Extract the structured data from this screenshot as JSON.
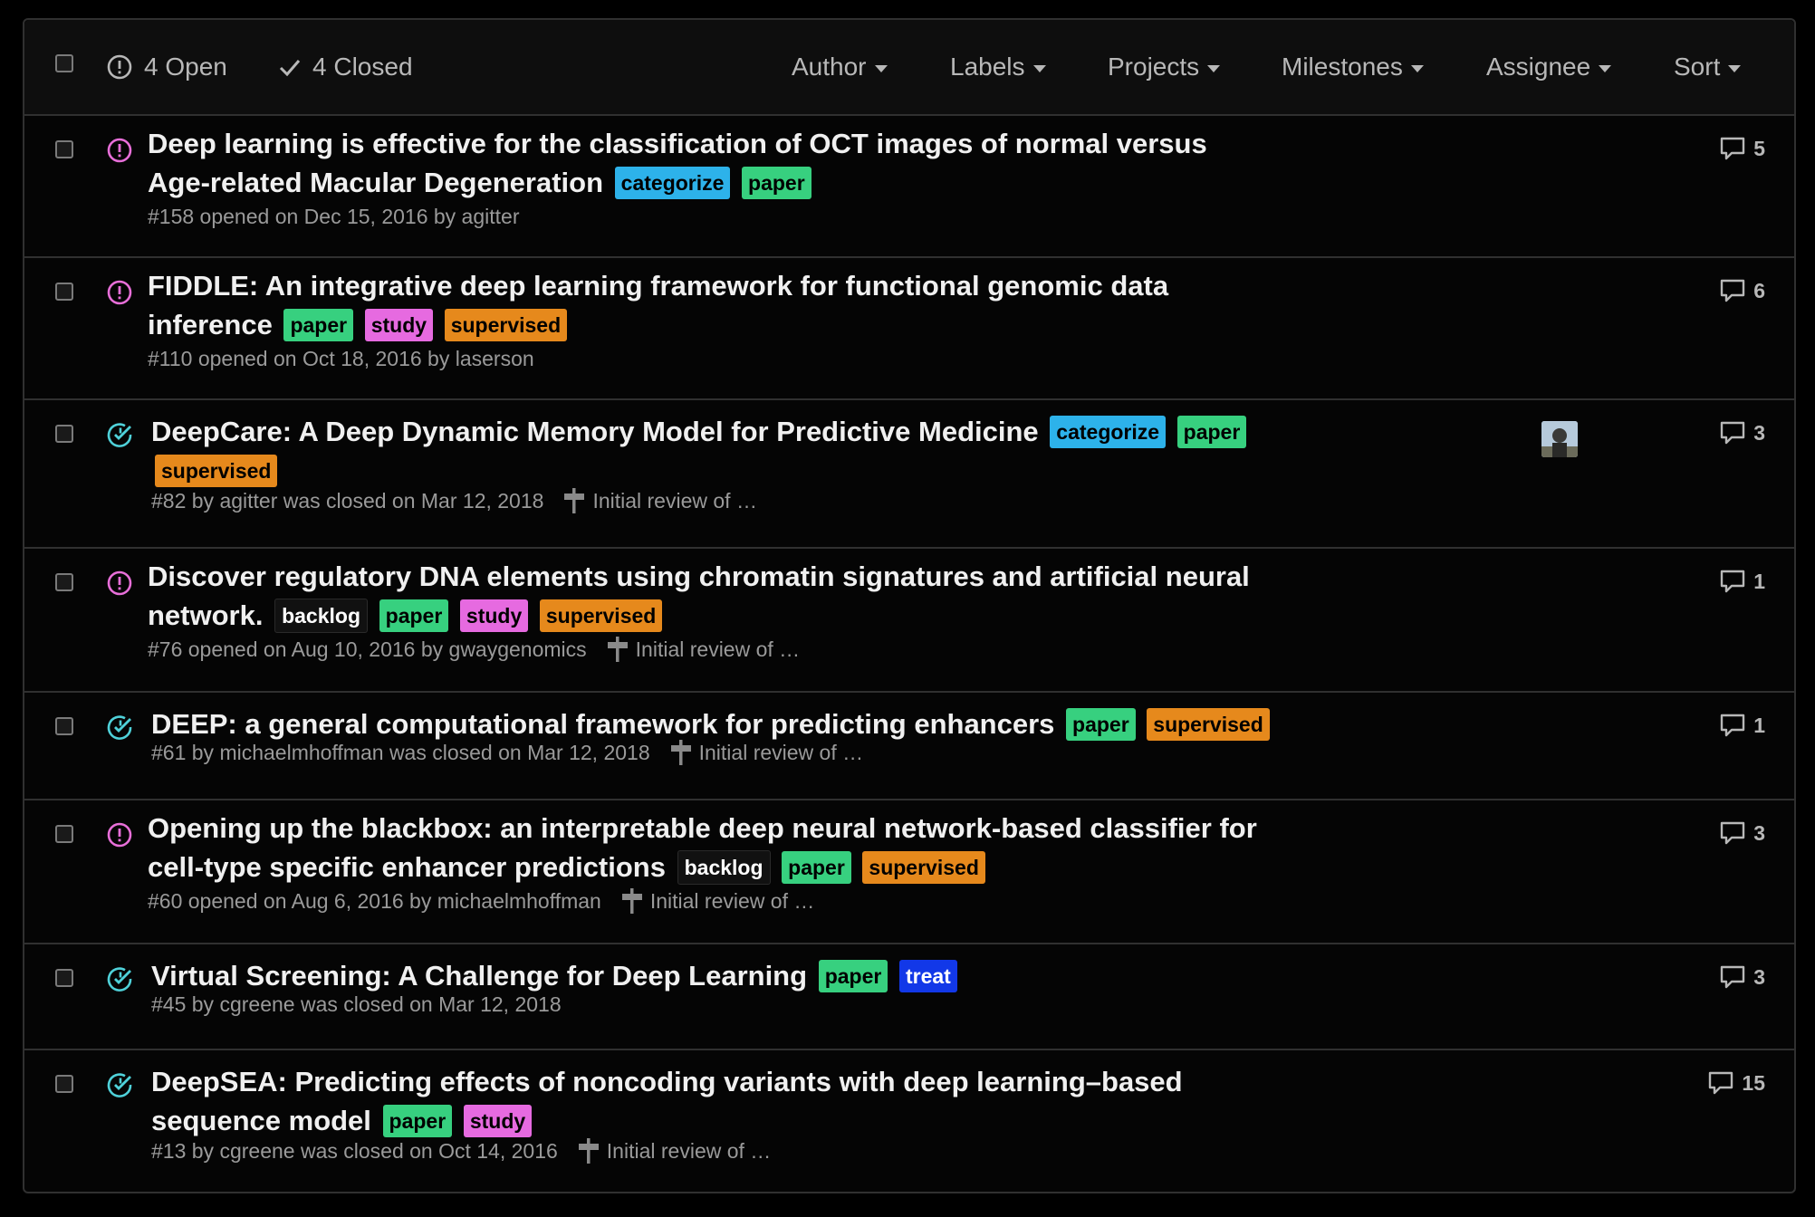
{
  "header": {
    "open_label": "4 Open",
    "closed_label": "4 Closed",
    "filters": [
      "Author",
      "Labels",
      "Projects",
      "Milestones",
      "Assignee",
      "Sort"
    ]
  },
  "colors": {
    "open_icon": "#e86fd9",
    "closed_icon": "#4fd1d9"
  },
  "issues": [
    {
      "state": "open",
      "title_lines": [
        "Deep learning is effective for the classification of OCT images of normal versus",
        "Age-related Macular Degeneration"
      ],
      "labels": [
        {
          "text": "categorize",
          "bg": "#2db2ea",
          "fg": "#000000"
        },
        {
          "text": "paper",
          "bg": "#37d07f",
          "fg": "#000000"
        }
      ],
      "meta": "#158 opened on Dec 15, 2016 by agitter",
      "milestone": "",
      "comments": "5",
      "avatar": false
    },
    {
      "state": "open",
      "title_lines": [
        "FIDDLE: An integrative deep learning framework for functional genomic data",
        "inference"
      ],
      "labels": [
        {
          "text": "paper",
          "bg": "#37d07f",
          "fg": "#000000"
        },
        {
          "text": "study",
          "bg": "#e66ae0",
          "fg": "#000000"
        },
        {
          "text": "supervised",
          "bg": "#e6891c",
          "fg": "#000000"
        }
      ],
      "meta": "#110 opened on Oct 18, 2016 by laserson",
      "milestone": "",
      "comments": "6",
      "avatar": false
    },
    {
      "state": "closed",
      "title_lines": [
        "DeepCare: A Deep Dynamic Memory Model for Predictive Medicine"
      ],
      "labels": [
        {
          "text": "categorize",
          "bg": "#2db2ea",
          "fg": "#000000"
        },
        {
          "text": "paper",
          "bg": "#37d07f",
          "fg": "#000000"
        },
        {
          "text": "supervised",
          "bg": "#e6891c",
          "fg": "#000000"
        }
      ],
      "meta": "#82 by agitter was closed on Mar 12, 2018",
      "milestone": "Initial review of …",
      "comments": "3",
      "avatar": true
    },
    {
      "state": "open",
      "title_lines": [
        "Discover regulatory DNA elements using chromatin signatures and artificial neural",
        "network."
      ],
      "labels": [
        {
          "text": "backlog",
          "bg": "#111111",
          "fg": "#ffffff"
        },
        {
          "text": "paper",
          "bg": "#37d07f",
          "fg": "#000000"
        },
        {
          "text": "study",
          "bg": "#e66ae0",
          "fg": "#000000"
        },
        {
          "text": "supervised",
          "bg": "#e6891c",
          "fg": "#000000"
        }
      ],
      "meta": "#76 opened on Aug 10, 2016 by gwaygenomics",
      "milestone": "Initial review of …",
      "comments": "1",
      "avatar": false
    },
    {
      "state": "closed",
      "title_lines": [
        "DEEP: a general computational framework for predicting enhancers"
      ],
      "labels": [
        {
          "text": "paper",
          "bg": "#37d07f",
          "fg": "#000000"
        },
        {
          "text": "supervised",
          "bg": "#e6891c",
          "fg": "#000000"
        }
      ],
      "meta": "#61 by michaelmhoffman was closed on Mar 12, 2018",
      "milestone": "Initial review of …",
      "comments": "1",
      "avatar": false
    },
    {
      "state": "open",
      "title_lines": [
        "Opening up the blackbox: an interpretable deep neural network-based classifier for",
        "cell-type specific enhancer predictions"
      ],
      "labels": [
        {
          "text": "backlog",
          "bg": "#111111",
          "fg": "#ffffff"
        },
        {
          "text": "paper",
          "bg": "#37d07f",
          "fg": "#000000"
        },
        {
          "text": "supervised",
          "bg": "#e6891c",
          "fg": "#000000"
        }
      ],
      "meta": "#60 opened on Aug 6, 2016 by michaelmhoffman",
      "milestone": "Initial review of …",
      "comments": "3",
      "avatar": false
    },
    {
      "state": "closed",
      "title_lines": [
        "Virtual Screening: A Challenge for Deep Learning"
      ],
      "labels": [
        {
          "text": "paper",
          "bg": "#37d07f",
          "fg": "#000000"
        },
        {
          "text": "treat",
          "bg": "#1238e8",
          "fg": "#ffffff"
        }
      ],
      "meta": "#45 by cgreene was closed on Mar 12, 2018",
      "milestone": "",
      "comments": "3",
      "avatar": false
    },
    {
      "state": "closed",
      "title_lines": [
        "DeepSEA: Predicting effects of noncoding variants with deep learning–based",
        "sequence model"
      ],
      "labels": [
        {
          "text": "paper",
          "bg": "#37d07f",
          "fg": "#000000"
        },
        {
          "text": "study",
          "bg": "#e66ae0",
          "fg": "#000000"
        }
      ],
      "meta": "#13 by cgreene was closed on Oct 14, 2016",
      "milestone": "Initial review of …",
      "comments": "15",
      "avatar": false
    }
  ]
}
